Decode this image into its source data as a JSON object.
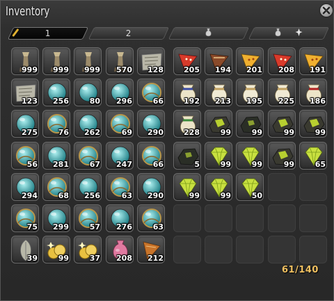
{
  "window": {
    "title": "Inventory"
  },
  "tabs": [
    {
      "label": "1",
      "icon": "key-item-icon",
      "active": true
    },
    {
      "label": "2",
      "icon": "",
      "active": false
    },
    {
      "label": "",
      "icon": "gil-bag-icon",
      "active": false
    },
    {
      "label": "",
      "icon": "gil-bag-plus-icon",
      "active": false
    }
  ],
  "capacity": "61/140",
  "left_grid": [
    [
      {
        "item": "stone-pestle",
        "qty": "999"
      },
      {
        "item": "stone-pestle",
        "qty": "999"
      },
      {
        "item": "stone-pestle",
        "qty": "999"
      },
      {
        "item": "stone-pestle",
        "qty": "570"
      },
      {
        "item": "treasure-map",
        "qty": "128"
      }
    ],
    [
      {
        "item": "treasure-map",
        "qty": "123"
      },
      {
        "item": "teal-crystal",
        "qty": "256"
      },
      {
        "item": "teal-crystal",
        "qty": "80"
      },
      {
        "item": "teal-crystal",
        "qty": "296"
      },
      {
        "item": "teal-cluster",
        "qty": "66"
      }
    ],
    [
      {
        "item": "teal-crystal",
        "qty": "275"
      },
      {
        "item": "teal-cluster",
        "qty": "76"
      },
      {
        "item": "teal-crystal",
        "qty": "262"
      },
      {
        "item": "teal-cluster",
        "qty": "69"
      },
      {
        "item": "teal-crystal",
        "qty": "290"
      }
    ],
    [
      {
        "item": "teal-cluster",
        "qty": "56"
      },
      {
        "item": "red-crystal",
        "qty": "281"
      },
      {
        "item": "red-cluster",
        "qty": "67"
      },
      {
        "item": "red-crystal",
        "qty": "247"
      },
      {
        "item": "red-cluster",
        "qty": "66"
      }
    ],
    [
      {
        "item": "red-crystal",
        "qty": "294"
      },
      {
        "item": "red-cluster",
        "qty": "68"
      },
      {
        "item": "gold-crystal",
        "qty": "256"
      },
      {
        "item": "gold-cluster",
        "qty": "63"
      },
      {
        "item": "gold-crystal",
        "qty": "290"
      }
    ],
    [
      {
        "item": "gold-cluster",
        "qty": "75"
      },
      {
        "item": "purple-crystal",
        "qty": "299"
      },
      {
        "item": "purple-cluster",
        "qty": "57"
      },
      {
        "item": "purple-crystal",
        "qty": "276"
      },
      {
        "item": "purple-cluster",
        "qty": "63"
      }
    ],
    [
      {
        "item": "silver-leaf",
        "qty": "39"
      },
      {
        "item": "gold-coins",
        "qty": "99"
      },
      {
        "item": "gold-coins",
        "qty": "37"
      },
      {
        "item": "pink-pouch",
        "qty": "208"
      },
      {
        "item": "cone-scroll",
        "qty": "212"
      }
    ]
  ],
  "right_grid": [
    [
      {
        "item": "red-cone",
        "qty": "205"
      },
      {
        "item": "brown-cone",
        "qty": "194"
      },
      {
        "item": "yellow-cone",
        "qty": "201"
      },
      {
        "item": "red-cone",
        "qty": "208"
      },
      {
        "item": "yellow-cone",
        "qty": "191"
      }
    ],
    [
      {
        "item": "blue-sack",
        "qty": "192"
      },
      {
        "item": "white-sack",
        "qty": "213"
      },
      {
        "item": "white-sack",
        "qty": "195"
      },
      {
        "item": "white-sack",
        "qty": "225"
      },
      {
        "item": "red-sack",
        "qty": "186"
      }
    ],
    [
      {
        "item": "green-sack",
        "qty": "228"
      },
      {
        "item": "green-ore",
        "qty": "99"
      },
      {
        "item": "dark-ore",
        "qty": "99"
      },
      {
        "item": "green-ore",
        "qty": "99"
      },
      {
        "item": "green-ore",
        "qty": "99"
      }
    ],
    [
      {
        "item": "dark-ore",
        "qty": "5"
      },
      {
        "item": "green-gem",
        "qty": "99"
      },
      {
        "item": "green-gem",
        "qty": "99"
      },
      {
        "item": "green-ore",
        "qty": "99"
      },
      {
        "item": "green-gem",
        "qty": "65"
      }
    ],
    [
      {
        "item": "green-gem",
        "qty": "99"
      },
      {
        "item": "green-gem",
        "qty": "99"
      },
      {
        "item": "green-gem",
        "qty": "50"
      },
      {
        "item": "",
        "qty": ""
      },
      {
        "item": "",
        "qty": ""
      }
    ],
    [
      {
        "item": "",
        "qty": ""
      },
      {
        "item": "",
        "qty": ""
      },
      {
        "item": "",
        "qty": ""
      },
      {
        "item": "",
        "qty": ""
      },
      {
        "item": "",
        "qty": ""
      }
    ],
    [
      {
        "item": "",
        "qty": ""
      },
      {
        "item": "",
        "qty": ""
      },
      {
        "item": "",
        "qty": ""
      },
      {
        "item": "",
        "qty": ""
      },
      {
        "item": "",
        "qty": ""
      }
    ]
  ]
}
